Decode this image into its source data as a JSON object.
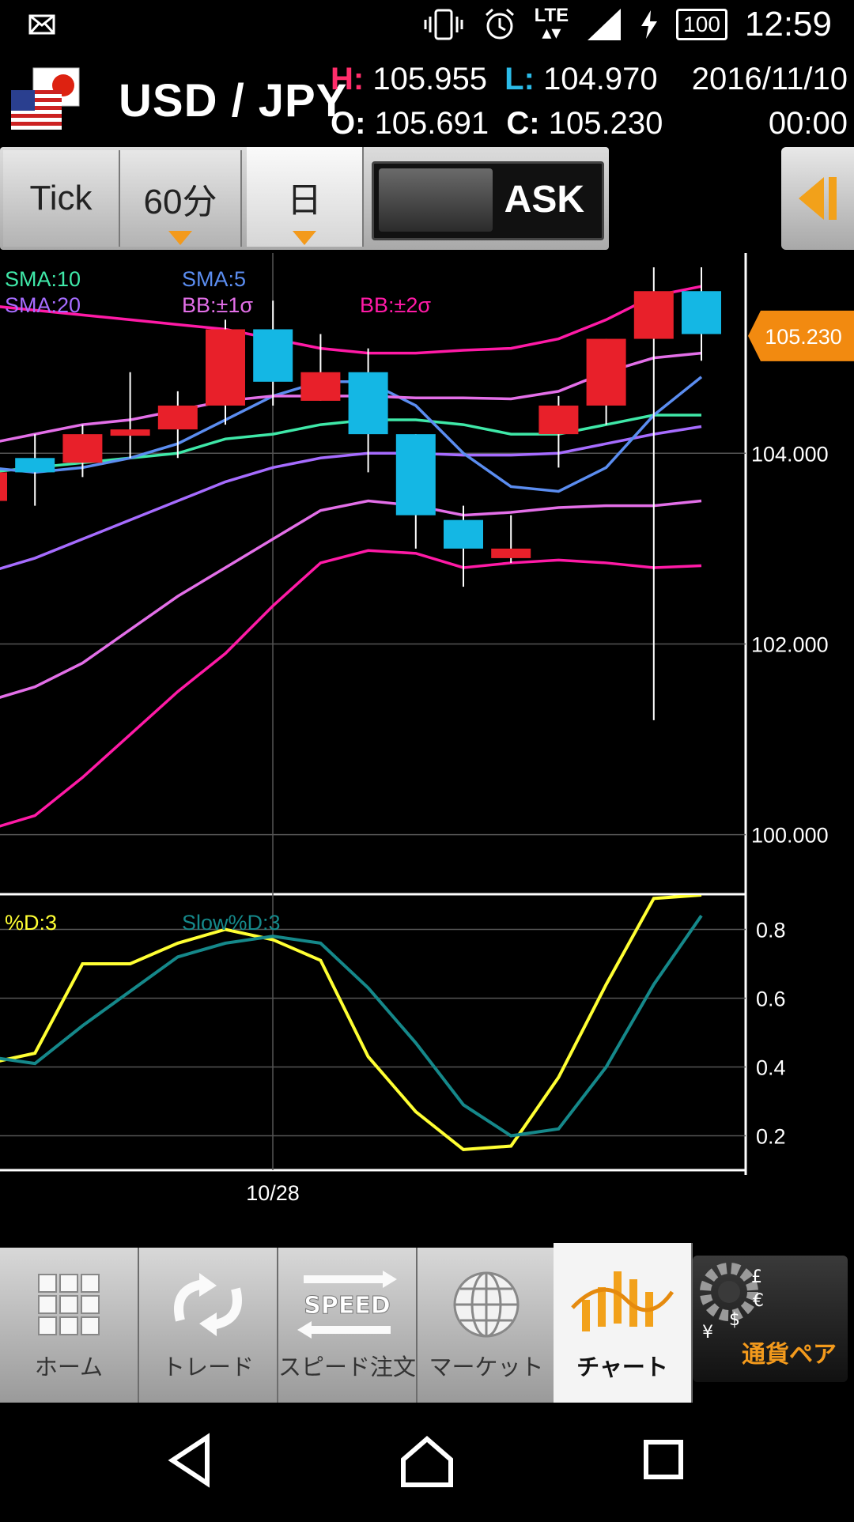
{
  "status_bar": {
    "time": "12:59",
    "network": "LTE",
    "battery": "100",
    "icons": [
      "mail-notification-icon",
      "vibrate-icon",
      "alarm-icon",
      "lte-icon",
      "signal-icon",
      "charging-icon",
      "battery-icon"
    ]
  },
  "header": {
    "pair": "USD / JPY",
    "high_label": "H:",
    "high": "105.955",
    "low_label": "L:",
    "low": "104.970",
    "open_label": "O:",
    "open": "105.691",
    "close_label": "C:",
    "close": "105.230",
    "date": "2016/11/10",
    "time": "00:00",
    "colors": {
      "high_label": "#ff2d6a",
      "low_label": "#2bbbe8"
    }
  },
  "tabs": [
    {
      "label": "Tick"
    },
    {
      "label": "60分"
    },
    {
      "label": "日"
    }
  ],
  "ask_toggle": {
    "label": "ASK"
  },
  "main_chart": {
    "legend": [
      {
        "text": "SMA:10",
        "color": "#3fe8a8"
      },
      {
        "text": "SMA:20",
        "color": "#a66cff"
      },
      {
        "text": "SMA:5",
        "color": "#5b8df0"
      },
      {
        "text": "BB:±1σ",
        "color": "#e36fe8"
      },
      {
        "text": "BB:±2σ",
        "color": "#ff1aa6"
      }
    ],
    "price_labels": [
      "104.000",
      "102.000",
      "100.000"
    ],
    "current_price": "105.230",
    "current_price_color": "#f28a10",
    "date_label": "10/28"
  },
  "oscillator": {
    "legend": [
      {
        "text": "%D:3",
        "color": "#ffff33"
      },
      {
        "text": "Slow%D:3",
        "color": "#15888a"
      }
    ],
    "ticks": [
      "0.8",
      "0.6",
      "0.4",
      "0.2"
    ]
  },
  "chart_data": {
    "type": "line",
    "title": "USD / JPY",
    "candles": {
      "up_color": "#e8202a",
      "down_color": "#14b7e4",
      "series": [
        {
          "o": 103.5,
          "h": 104.0,
          "l": 103.5,
          "c": 103.8
        },
        {
          "o": 103.95,
          "h": 104.2,
          "l": 103.45,
          "c": 103.8
        },
        {
          "o": 103.9,
          "h": 104.3,
          "l": 103.75,
          "c": 104.2
        },
        {
          "o": 104.2,
          "h": 104.85,
          "l": 103.95,
          "c": 104.25
        },
        {
          "o": 104.25,
          "h": 104.65,
          "l": 103.95,
          "c": 104.5
        },
        {
          "o": 104.5,
          "h": 105.4,
          "l": 104.3,
          "c": 105.3
        },
        {
          "o": 105.3,
          "h": 105.6,
          "l": 104.5,
          "c": 104.75
        },
        {
          "o": 104.55,
          "h": 105.25,
          "l": 104.55,
          "c": 104.85
        },
        {
          "o": 104.85,
          "h": 105.1,
          "l": 103.8,
          "c": 104.2
        },
        {
          "o": 104.2,
          "h": 104.2,
          "l": 103.0,
          "c": 103.35
        },
        {
          "o": 103.3,
          "h": 103.45,
          "l": 102.6,
          "c": 103.0
        },
        {
          "o": 102.9,
          "h": 103.35,
          "l": 102.85,
          "c": 103.0
        },
        {
          "o": 104.2,
          "h": 104.6,
          "l": 103.85,
          "c": 104.5
        },
        {
          "o": 104.5,
          "h": 105.2,
          "l": 104.3,
          "c": 105.2
        },
        {
          "o": 105.2,
          "h": 105.95,
          "l": 101.2,
          "c": 105.7
        },
        {
          "o": 105.7,
          "h": 105.95,
          "l": 104.97,
          "c": 105.25
        }
      ]
    },
    "series": [
      {
        "name": "SMA:10",
        "values": [
          103.8,
          103.85,
          103.9,
          103.95,
          104.0,
          104.15,
          104.2,
          104.3,
          104.35,
          104.35,
          104.3,
          104.2,
          104.2,
          104.3,
          104.4,
          104.4
        ]
      },
      {
        "name": "SMA:20",
        "values": [
          102.75,
          102.9,
          103.1,
          103.3,
          103.5,
          103.7,
          103.85,
          103.95,
          104.0,
          104.0,
          103.98,
          103.98,
          104.0,
          104.1,
          104.2,
          104.28
        ]
      },
      {
        "name": "SMA:5",
        "values": [
          103.85,
          103.8,
          103.85,
          103.95,
          104.1,
          104.35,
          104.6,
          104.75,
          104.75,
          104.5,
          104.0,
          103.65,
          103.6,
          103.85,
          104.4,
          104.8
        ]
      },
      {
        "name": "BB:±1σ upper",
        "values": [
          104.1,
          104.2,
          104.3,
          104.35,
          104.45,
          104.55,
          104.6,
          104.6,
          104.6,
          104.58,
          104.58,
          104.57,
          104.65,
          104.85,
          105.0,
          105.05
        ]
      },
      {
        "name": "BB:±1σ lower",
        "values": [
          101.4,
          101.55,
          101.8,
          102.15,
          102.5,
          102.8,
          103.1,
          103.4,
          103.5,
          103.45,
          103.35,
          103.38,
          103.43,
          103.45,
          103.45,
          103.5
        ]
      },
      {
        "name": "BB:±2σ upper",
        "values": [
          105.55,
          105.5,
          105.45,
          105.4,
          105.35,
          105.3,
          105.2,
          105.1,
          105.05,
          105.05,
          105.08,
          105.1,
          105.2,
          105.4,
          105.65,
          105.75
        ]
      },
      {
        "name": "BB:±2σ lower",
        "values": [
          100.05,
          100.2,
          100.6,
          101.05,
          101.5,
          101.9,
          102.4,
          102.85,
          102.98,
          102.95,
          102.8,
          102.85,
          102.88,
          102.85,
          102.8,
          102.82
        ]
      }
    ],
    "ylim": [
      99.4,
      106.1
    ],
    "oscillator_series": [
      {
        "name": "%D:3",
        "values": [
          0.41,
          0.44,
          0.7,
          0.7,
          0.76,
          0.8,
          0.77,
          0.71,
          0.43,
          0.27,
          0.16,
          0.17,
          0.37,
          0.64,
          0.89,
          0.9
        ]
      },
      {
        "name": "Slow%D:3",
        "values": [
          0.43,
          0.41,
          0.52,
          0.62,
          0.72,
          0.76,
          0.78,
          0.76,
          0.63,
          0.47,
          0.29,
          0.2,
          0.22,
          0.4,
          0.64,
          0.84
        ]
      }
    ],
    "oscillator_ylim": [
      0.1,
      0.9
    ],
    "xlabel_ticks": [
      "10/28"
    ]
  },
  "bottom_nav": [
    {
      "label": "ホーム",
      "icon": "home-grid-icon"
    },
    {
      "label": "トレード",
      "icon": "trade-arrows-icon"
    },
    {
      "label": "スピード注文",
      "icon": "speed-order-icon"
    },
    {
      "label": "マーケット",
      "icon": "market-globe-icon"
    },
    {
      "label": "チャート",
      "icon": "chart-icon"
    }
  ],
  "currency_pair_button": {
    "label": "通貨ペア",
    "icon": "currency-gear-icon"
  }
}
